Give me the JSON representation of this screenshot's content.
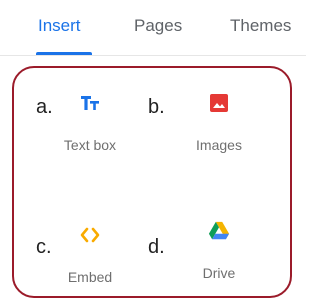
{
  "tabs": [
    {
      "label": "Insert",
      "active": true
    },
    {
      "label": "Pages",
      "active": false
    },
    {
      "label": "Themes",
      "active": false
    }
  ],
  "items": [
    {
      "letter": "a.",
      "label": "Text box",
      "icon": "text-box-icon"
    },
    {
      "letter": "b.",
      "label": "Images",
      "icon": "image-icon"
    },
    {
      "letter": "c.",
      "label": "Embed",
      "icon": "embed-icon"
    },
    {
      "letter": "d.",
      "label": "Drive",
      "icon": "drive-icon"
    }
  ],
  "colors": {
    "accent": "#1a73e8",
    "annotation": "#9b1b2a",
    "images_icon": "#e53935",
    "embed_icon": "#f9ab00",
    "drive_green": "#0f9d58",
    "drive_yellow": "#f4b400",
    "drive_blue": "#4285f4"
  }
}
